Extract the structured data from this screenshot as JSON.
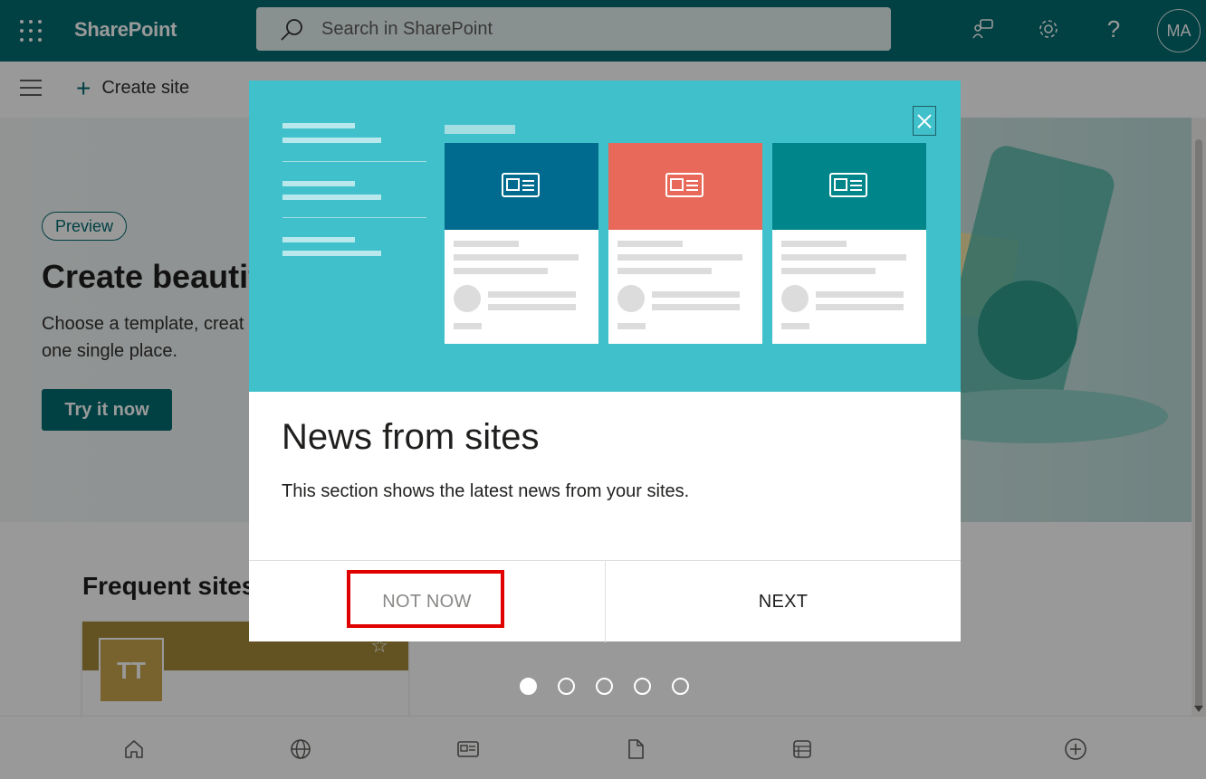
{
  "app": {
    "brand": "SharePoint",
    "search_placeholder": "Search in SharePoint",
    "avatar_initials": "MA"
  },
  "commandbar": {
    "create_site_label": "Create site"
  },
  "hero": {
    "badge": "Preview",
    "title": "Create beautif",
    "description": "Choose a template, creat one single place.",
    "cta_label": "Try it now"
  },
  "frequent_sites": {
    "title": "Frequent sites",
    "sites": [
      {
        "initials": "TT"
      }
    ]
  },
  "dialog": {
    "title": "News from sites",
    "body": "This section shows the latest news from your sites.",
    "not_now_label": "NOT NOW",
    "next_label": "NEXT",
    "close_label": "Close",
    "card_colors": [
      "#006b8f",
      "#e8695a",
      "#00858a"
    ]
  },
  "pager": {
    "total": 5,
    "current": 1
  },
  "colors": {
    "theme": "#036c70",
    "dialog_illustration_bg": "#40c0cb",
    "highlight": "#e00000"
  }
}
